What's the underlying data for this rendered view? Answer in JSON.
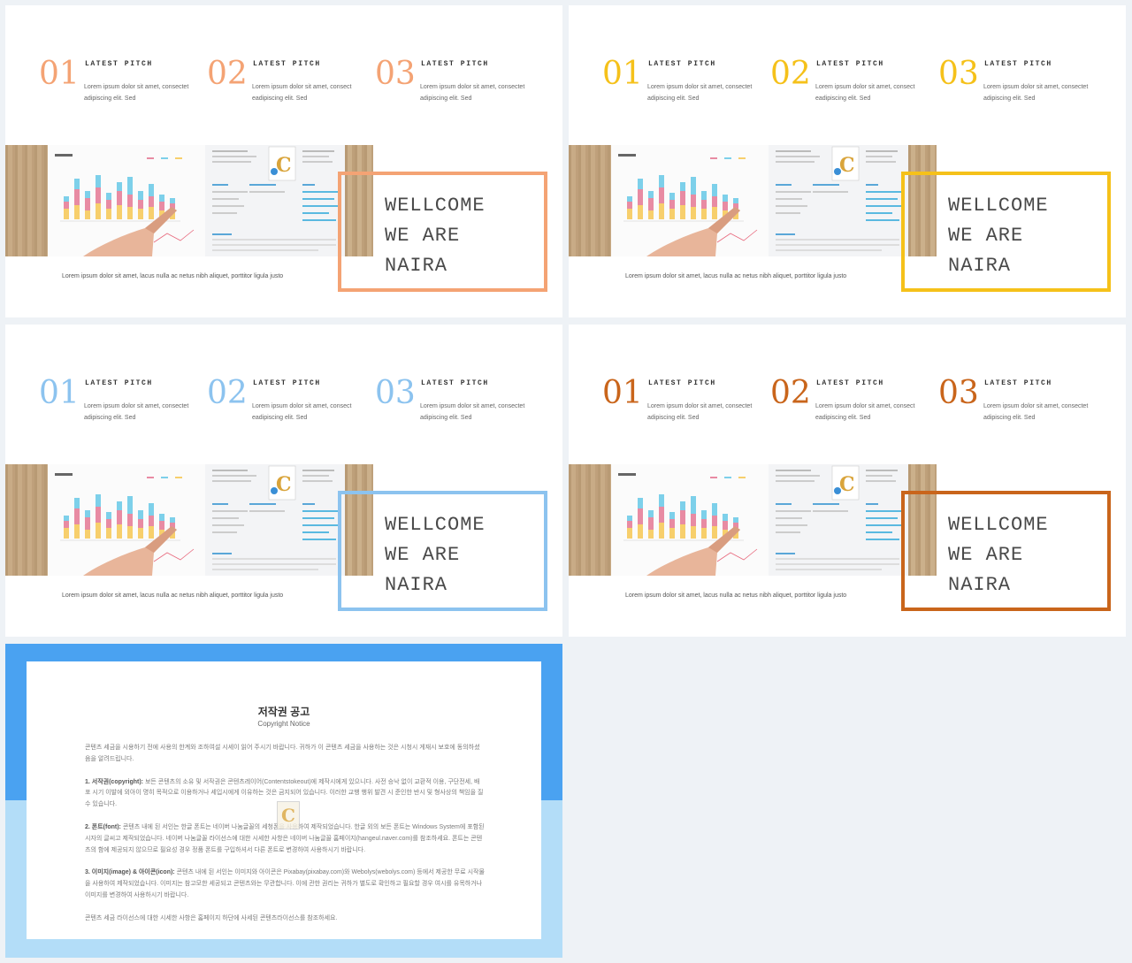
{
  "slides": [
    {
      "accent": "#f4a374",
      "items": [
        {
          "num": "01",
          "title": "LATEST PITCH",
          "desc": "Lorem ipsum dolor sit amet, consectet adipiscing elit. Sed"
        },
        {
          "num": "02",
          "title": "LATEST PITCH",
          "desc": "Lorem ipsum dolor sit amet, consect eadipiscing elit. Sed"
        },
        {
          "num": "03",
          "title": "LATEST PITCH",
          "desc": "Lorem ipsum dolor sit amet, consectet adipiscing elit. Sed"
        }
      ],
      "caption": "Lorem ipsum dolor sit amet, lacus nulla ac netus nibh aliquet, porttitor ligula justo",
      "frame_lines": [
        "WELLCOME",
        "WE ARE",
        "NAIRA"
      ]
    },
    {
      "accent": "#f5c11a",
      "items": [
        {
          "num": "01",
          "title": "LATEST PITCH",
          "desc": "Lorem ipsum dolor sit amet, consectet adipiscing elit. Sed"
        },
        {
          "num": "02",
          "title": "LATEST PITCH",
          "desc": "Lorem ipsum dolor sit amet, consect eadipiscing elit. Sed"
        },
        {
          "num": "03",
          "title": "LATEST PITCH",
          "desc": "Lorem ipsum dolor sit amet, consectet adipiscing elit. Sed"
        }
      ],
      "caption": "Lorem ipsum dolor sit amet, lacus nulla ac netus nibh aliquet, porttitor ligula justo",
      "frame_lines": [
        "WELLCOME",
        "WE ARE",
        "NAIRA"
      ]
    },
    {
      "accent": "#8cc3ef",
      "items": [
        {
          "num": "01",
          "title": "LATEST PITCH",
          "desc": "Lorem ipsum dolor sit amet, consectet adipiscing elit. Sed"
        },
        {
          "num": "02",
          "title": "LATEST PITCH",
          "desc": "Lorem ipsum dolor sit amet, consect eadipiscing elit. Sed"
        },
        {
          "num": "03",
          "title": "LATEST PITCH",
          "desc": "Lorem ipsum dolor sit amet, consectet adipiscing elit. Sed"
        }
      ],
      "caption": "Lorem ipsum dolor sit amet, lacus nulla ac netus nibh aliquet, porttitor ligula justo",
      "frame_lines": [
        "WELLCOME",
        "WE ARE",
        "NAIRA"
      ]
    },
    {
      "accent": "#c9651b",
      "items": [
        {
          "num": "01",
          "title": "LATEST PITCH",
          "desc": "Lorem ipsum dolor sit amet, consectet adipiscing elit. Sed"
        },
        {
          "num": "02",
          "title": "LATEST PITCH",
          "desc": "Lorem ipsum dolor sit amet, consect eadipiscing elit. Sed"
        },
        {
          "num": "03",
          "title": "LATEST PITCH",
          "desc": "Lorem ipsum dolor sit amet, consectet adipiscing elit. Sed"
        }
      ],
      "caption": "Lorem ipsum dolor sit amet, lacus nulla ac netus nibh aliquet, porttitor ligula justo",
      "frame_lines": [
        "WELLCOME",
        "WE ARE",
        "NAIRA"
      ]
    }
  ],
  "notice": {
    "title": "저작권 공고",
    "subtitle": "Copyright Notice",
    "intro": "콘텐츠 세금을 시용하기 전에 사용의 한계와 조하여설 시세이 읽어 주시기 바랍니다. 귀하가 이 콘텐츠 세금을 사용하는 것은 시청시 게재시 보호에 동의하셨음을 알려드립니다.",
    "sections": [
      {
        "head": "1. 서작권(copyright):",
        "text": "보든 콘텐츠의 소유 및 서작권은 콘텐츠레이어(Contentstokeout)에 제작시에게 있으니다. 사전 승낙 없이 교환적 이용, 구단전세, 배포 시기 이발에 외아이 명히 목적으로 이용하거나 세입시에게 이유하는 것은 금지되어 있습니다. 이러한 교행 행위 발견 시 준인한 반시 및 형사상의 책임을 질 수 있습니다."
      },
      {
        "head": "2. 폰트(font):",
        "text": "콘텐츠 내에 된 서인는 한글 폰트는 네이버 나눔글꼴의 세청폰을 사용하여 제작되었습니다. 한글 외의 보든 폰트는 Windows System에 포함된 시자의 글씨고 제작되었습니다. 네이버 나눔글꼴 라이선스에 대한 시세한 사항은 네이버 나눔글꼴 홈페이지(hangeul.naver.com)를 참조하세요. 폰트는 콘텐츠의 함에 제공되지 않으므로 필요성 경우 정품 폰트를 구입하셔서 다른 폰트로 변경하여 사용하시기 바랍니다."
      },
      {
        "head": "3. 이미지(image) & 아이콘(icon):",
        "text": "콘텐츠 내에 된 서인는 이미지와 아이콘은 Pixabay(pixabay.com)와 Webolys(webolys.com) 등에서 제공한 무료 시작물을 사용하여 제작되었습니다. 이미지는 참고모한 세공되고 콘텐츠와는 무관합니다. 이에 관한 권리는 귀하가 별도로 확인하고 필요할 경우 여시를 유목하거나 이미지를 변경하여 사용하시기 바랍니다."
      }
    ],
    "outro": "콘텐츠 세금 라이선스에 대한 시세한 사항은 홈페이지 하단에 사세된 콘텐츠라이선스를 참조하세요.",
    "logo_letter": "C",
    "colors": {
      "top": "#4aa2f1",
      "bottom": "#b3ddf8"
    }
  }
}
